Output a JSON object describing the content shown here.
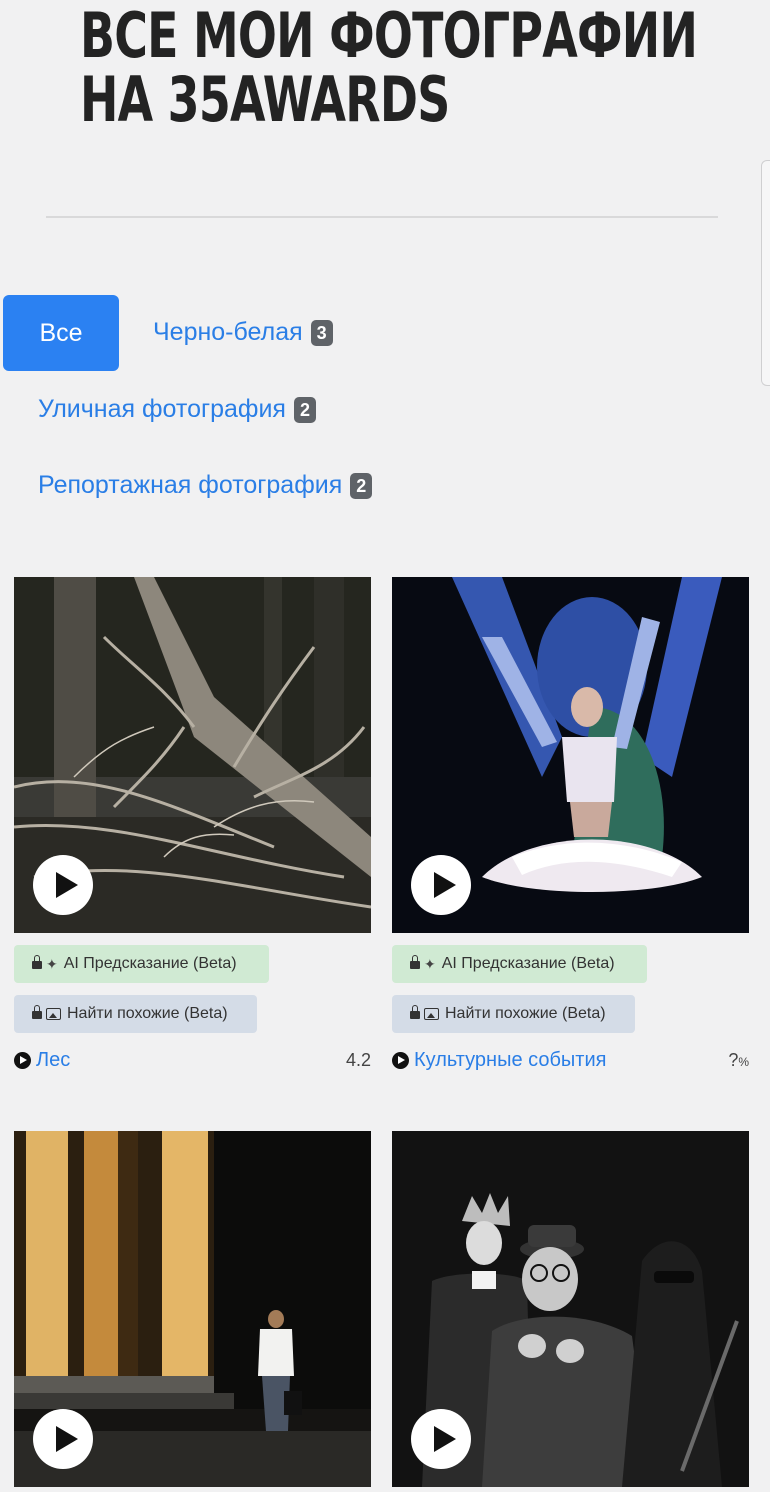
{
  "page": {
    "title_line1": "ВСЕ МОИ ФОТОГРАФИИ",
    "title_line2": "НА 35AWARDS"
  },
  "filters": [
    {
      "label": "Все",
      "active": true
    },
    {
      "label": "Черно-белая",
      "count": "3"
    },
    {
      "label": "Уличная фотография",
      "count": "2"
    },
    {
      "label": "Репортажная фотография",
      "count": "2"
    }
  ],
  "photos": [
    {
      "ai_label": "AI Предсказание (Beta)",
      "similar_label": "Найти похожие (Beta)",
      "category": "Лес",
      "score": "4.2",
      "image": "forest-fallen-tree"
    },
    {
      "ai_label": "AI Предсказание (Beta)",
      "similar_label": "Найти похожие (Beta)",
      "category": "Культурные события",
      "score": "?",
      "score_unit": "%",
      "image": "ballet-dancer-blue"
    },
    {
      "image": "colonnade-woman-walking"
    },
    {
      "image": "theatre-actors-bw"
    }
  ],
  "colors": {
    "accent": "#2b81f2",
    "link": "#2a7ee6",
    "badge": "#5f6368",
    "ai_pill": "#d0ead3",
    "similar_pill": "#d4dce7"
  }
}
